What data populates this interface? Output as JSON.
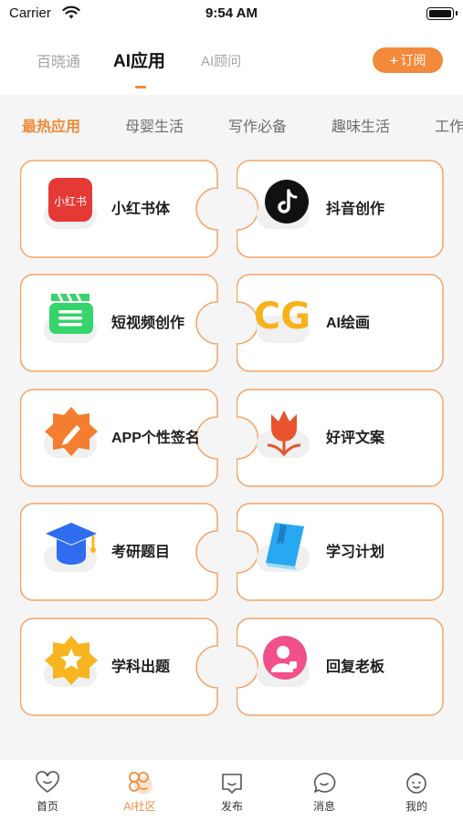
{
  "status_bar": {
    "carrier": "Carrier",
    "time": "9:54 AM"
  },
  "top_nav": {
    "tabs": [
      {
        "label": "百晓通"
      },
      {
        "label": "AI应用"
      },
      {
        "label": "AI顾问"
      }
    ],
    "subscribe": {
      "plus": "+",
      "label": "订阅"
    }
  },
  "categories": [
    "最热应用",
    "母婴生活",
    "写作必备",
    "趣味生活",
    "工作"
  ],
  "apps": [
    {
      "label": "小红书体",
      "icon": "xiaohongshu-icon",
      "icon_text": "小红书",
      "color": "#e53935"
    },
    {
      "label": "抖音创作",
      "icon": "douyin-icon",
      "color": "#111111"
    },
    {
      "label": "短视频创作",
      "icon": "video-clapper-icon",
      "color": "#37d36b"
    },
    {
      "label": "AI绘画",
      "icon": "cg-icon",
      "icon_text": "CG",
      "color": "#f6b21a"
    },
    {
      "label": "APP个性签名",
      "icon": "pen-badge-icon",
      "color": "#f47d2f"
    },
    {
      "label": "好评文案",
      "icon": "tulip-icon",
      "color": "#e8532e"
    },
    {
      "label": "考研题目",
      "icon": "graduation-cap-icon",
      "color": "#2f6cf0"
    },
    {
      "label": "学习计划",
      "icon": "book-icon",
      "color": "#28a8f0"
    },
    {
      "label": "学科出题",
      "icon": "star-badge-icon",
      "color": "#f7b520"
    },
    {
      "label": "回复老板",
      "icon": "boss-avatar-icon",
      "color": "#f2508a"
    }
  ],
  "bottom_nav": [
    {
      "label": "首页",
      "icon": "heart-face-icon"
    },
    {
      "label": "AI社区",
      "icon": "clover-icon"
    },
    {
      "label": "发布",
      "icon": "post-icon"
    },
    {
      "label": "消息",
      "icon": "message-icon"
    },
    {
      "label": "我的",
      "icon": "baby-face-icon"
    }
  ],
  "colors": {
    "accent": "#f08a3c",
    "card_border": "#f3a467"
  }
}
